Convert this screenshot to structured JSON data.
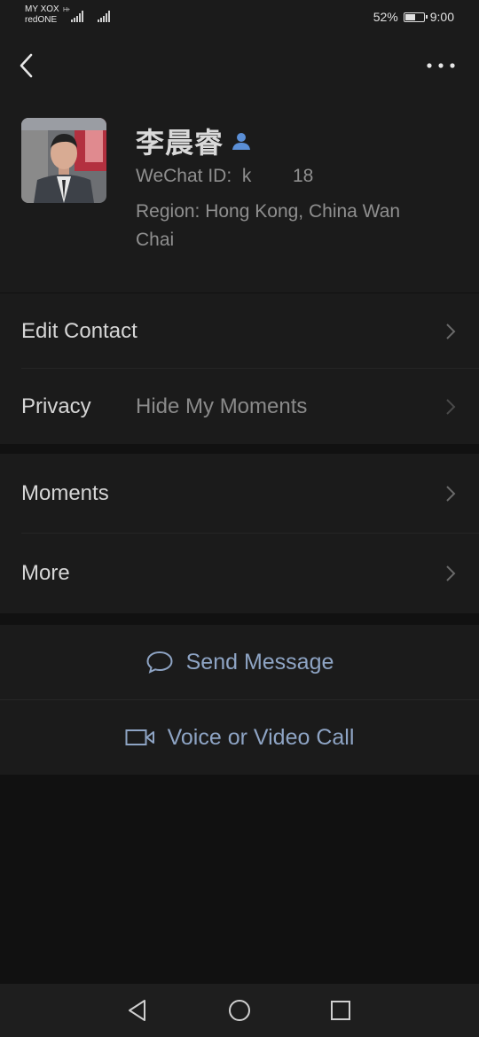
{
  "status_bar": {
    "carrier_line1": "MY XOX",
    "carrier_line2": "redONE",
    "net_type": "H+",
    "battery_pct": "52%",
    "battery_level": 0.52,
    "time": "9:00"
  },
  "profile": {
    "name": "李晨睿",
    "wechat_id": "WeChat ID:  k        18",
    "region": "Region:  Hong Kong, China  Wan Chai"
  },
  "menu1": [
    {
      "label": "Edit Contact",
      "value": ""
    },
    {
      "label": "Privacy",
      "value": "Hide My Moments"
    }
  ],
  "menu2": [
    {
      "label": "Moments"
    },
    {
      "label": "More"
    }
  ],
  "actions": {
    "send_message": "Send Message",
    "voice_video": "Voice or Video Call"
  },
  "colors": {
    "background": "#111111",
    "panel": "#1b1b1b",
    "accent_link": "#8ea4c4",
    "person_icon": "#5b8fd6"
  }
}
